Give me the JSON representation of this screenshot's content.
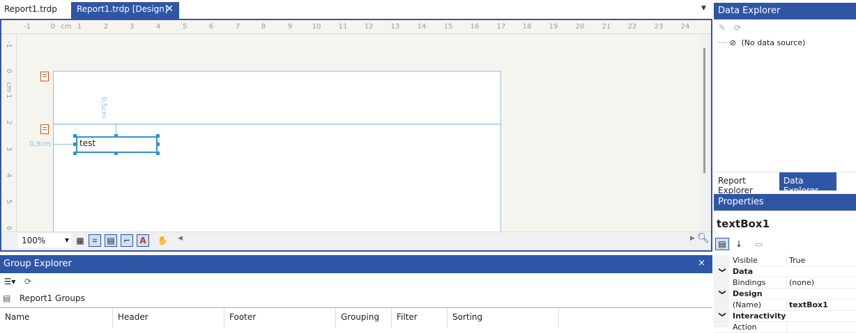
{
  "tabs": [
    {
      "label": "Report1.trdp",
      "active": false
    },
    {
      "label": "Report1.trdp [Design]",
      "active": true
    }
  ],
  "tab_close_icon": "close-icon",
  "designer": {
    "ruler_h": [
      "-1",
      "0",
      "cm",
      "1",
      "2",
      "3",
      "4",
      "5",
      "6",
      "7",
      "8",
      "9",
      "10",
      "11",
      "12",
      "13",
      "14",
      "15",
      "16",
      "17",
      "18",
      "19",
      "20",
      "21",
      "22",
      "23",
      "24"
    ],
    "ruler_v": [
      "-1",
      "0",
      "cm",
      "1",
      "2",
      "3",
      "4",
      "5",
      "6"
    ],
    "textbox_value": "test",
    "dim_vertical": "0,5cm",
    "dim_horizontal": "0,9cm",
    "zoom": "100%"
  },
  "group_explorer": {
    "title": "Group Explorer",
    "close": "×",
    "groups_label": "Report1 Groups",
    "columns": [
      "Name",
      "Header",
      "Footer",
      "Grouping",
      "Filter",
      "Sorting"
    ]
  },
  "data_explorer": {
    "title": "Data Explorer",
    "tree_item": "(No data source)"
  },
  "explorer_tabs": [
    {
      "label": "Report Explorer",
      "active": false
    },
    {
      "label": "Data Explorer",
      "active": true
    }
  ],
  "properties": {
    "title": "Properties",
    "object_name": "textBox1",
    "rows": [
      {
        "type": "prop",
        "key": "Visible",
        "value": "True"
      },
      {
        "type": "cat",
        "key": "Data"
      },
      {
        "type": "prop",
        "key": "Bindings",
        "value": "(none)"
      },
      {
        "type": "cat",
        "key": "Design"
      },
      {
        "type": "prop",
        "key": "(Name)",
        "value": "textBox1",
        "bold": true
      },
      {
        "type": "cat",
        "key": "Interactivity"
      },
      {
        "type": "prop",
        "key": "Action",
        "value": ""
      }
    ]
  },
  "colors": {
    "accent": "#2f56a5",
    "selection": "#2b92d0",
    "guide": "#8fc3e0"
  }
}
